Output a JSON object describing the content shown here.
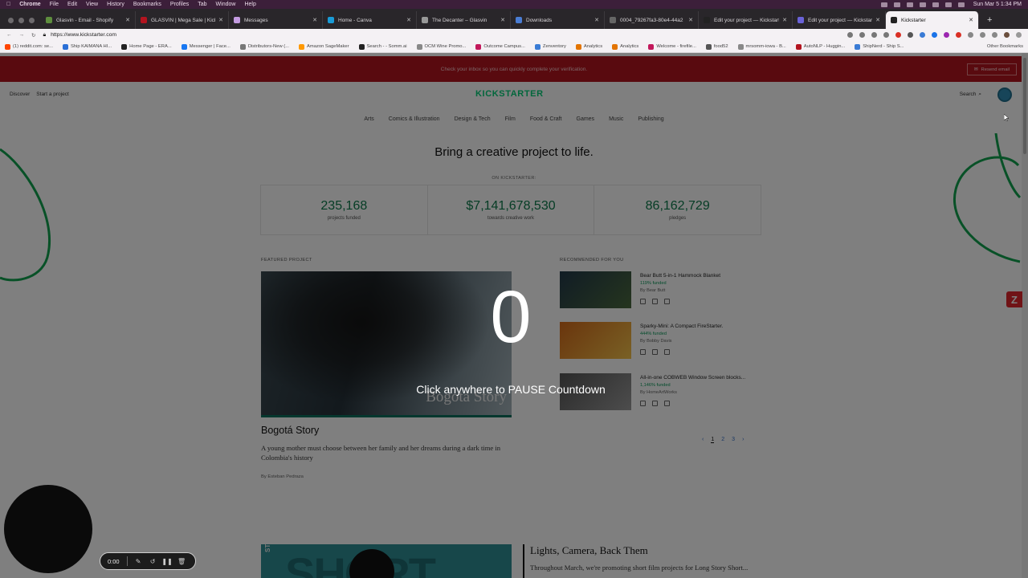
{
  "mac_menu": {
    "app": "Chrome",
    "items": [
      "File",
      "Edit",
      "View",
      "History",
      "Bookmarks",
      "Profiles",
      "Tab",
      "Window",
      "Help"
    ],
    "clock": "Sun Mar 5  1:34 PM"
  },
  "tabs": [
    {
      "label": "Glasvin - Email - Shopify",
      "color": "#5e8e3e"
    },
    {
      "label": "GLASVIN | Mega Sale | Kickstarter",
      "color": "#b3141f"
    },
    {
      "label": "Messages",
      "color": "#c39be0"
    },
    {
      "label": "Home - Canva",
      "color": "#1a9bd6"
    },
    {
      "label": "The Decanter – Glasvin",
      "color": "#999999"
    },
    {
      "label": "Downloads",
      "color": "#4a7dd4"
    },
    {
      "label": "0004_79267fa3-80e4-44a2",
      "color": "#666666"
    },
    {
      "label": "Edit your project — Kickstarter",
      "color": "#222222"
    },
    {
      "label": "Edit your project — Kickstarter",
      "color": "#6a62d8"
    },
    {
      "label": "Kickstarter",
      "color": "#222222",
      "active": true
    }
  ],
  "address": {
    "url": "https://www.kickstarter.com"
  },
  "bookmarks": [
    {
      "label": "(1) reddit.com: se...",
      "color": "#ff4500"
    },
    {
      "label": "Ship KAIMANA HI...",
      "color": "#2a6fd6"
    },
    {
      "label": "Home Page - ERA...",
      "color": "#222222"
    },
    {
      "label": "Messenger | Face...",
      "color": "#1877f2"
    },
    {
      "label": "Distributors-New (...",
      "color": "#777777"
    },
    {
      "label": "Amazon SageMaker",
      "color": "#ff9900"
    },
    {
      "label": "Search - - Somm.ai",
      "color": "#222222"
    },
    {
      "label": "OCM Wine Promo...",
      "color": "#888888"
    },
    {
      "label": "Outcome Campus...",
      "color": "#c2185b"
    },
    {
      "label": "Zenventory",
      "color": "#3a7bd5"
    },
    {
      "label": "Analytics",
      "color": "#e37400"
    },
    {
      "label": "Analytics",
      "color": "#e37400"
    },
    {
      "label": "Welcome - firefile...",
      "color": "#c2185b"
    },
    {
      "label": "food52",
      "color": "#555555"
    },
    {
      "label": "mrsomm-iowa - B...",
      "color": "#888888"
    },
    {
      "label": "AutoNLP - Huggin...",
      "color": "#b3141f"
    },
    {
      "label": "ShipNerd - Ship S...",
      "color": "#3a7bd5"
    }
  ],
  "bookmarks_other": "Other Bookmarks",
  "banner": {
    "text": "Check your inbox so you can quickly complete your verification.",
    "button": "Resend email"
  },
  "ksnav": {
    "discover": "Discover",
    "start": "Start a project",
    "logo": "KICKSTARTER",
    "search": "Search"
  },
  "categories": [
    "Arts",
    "Comics & Illustration",
    "Design & Tech",
    "Film",
    "Food & Craft",
    "Games",
    "Music",
    "Publishing"
  ],
  "hero": "Bring a creative project to life.",
  "on_ks": "ON KICKSTARTER:",
  "stats": [
    {
      "num": "235,168",
      "cap": "projects funded"
    },
    {
      "num": "$7,141,678,530",
      "cap": "towards creative work"
    },
    {
      "num": "86,162,729",
      "cap": "pledges"
    }
  ],
  "featured": {
    "label": "FEATURED PROJECT",
    "image_title": "Bogotá Story",
    "title": "Bogotá Story",
    "desc": "A young mother must choose between her family and her dreams during a dark time in Colombia's history",
    "by": "By Esteban Pedraza"
  },
  "recommended": {
    "label": "RECOMMENDED FOR YOU",
    "items": [
      {
        "title": "Bear Butt 5-in-1 Hammock Blanket",
        "funded": "119% funded",
        "by": "By Bear Butt",
        "c1": "#22394a",
        "c2": "#4b6a3e"
      },
      {
        "title": "Sparky-Mini: A Compact FireStarter.",
        "funded": "444% funded",
        "by": "By Bobby Davis",
        "c1": "#d46a1a",
        "c2": "#f3c24a"
      },
      {
        "title": "All-in-one COBWEB Window Screen blocks...",
        "funded": "1,146% funded",
        "by": "By HomeArtWorks",
        "c1": "#555555",
        "c2": "#9a9a9a"
      }
    ]
  },
  "pager": [
    "1",
    "2",
    "3"
  ],
  "lower": {
    "img_word": "SHORT",
    "side_word": "STORY",
    "title": "Lights, Camera, Back Them",
    "text": "Throughout March, we're promoting short film projects for Long Story Short..."
  },
  "overlay": {
    "count": "0",
    "message": "Click anywhere to PAUSE Countdown"
  },
  "recorder": {
    "time": "0:00"
  }
}
